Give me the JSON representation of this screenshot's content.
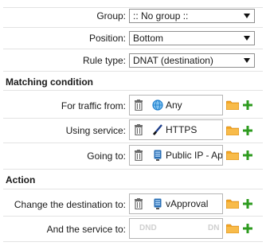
{
  "general": {
    "group": {
      "label": "Group:",
      "value": ":: No group ::"
    },
    "position": {
      "label": "Position:",
      "value": "Bottom"
    },
    "rule_type": {
      "label": "Rule type:",
      "value": "DNAT (destination)"
    }
  },
  "matching": {
    "title": "Matching condition",
    "traffic_from": {
      "label": "For traffic from:",
      "value": "Any",
      "icon": "globe-icon"
    },
    "service": {
      "label": "Using service:",
      "value": "HTTPS",
      "icon": "service-icon"
    },
    "going_to": {
      "label": "Going to:",
      "value": "Public IP - Ap",
      "icon": "network-icon"
    }
  },
  "action": {
    "title": "Action",
    "change_destination": {
      "label": "Change the destination to:",
      "value": "vApproval",
      "icon": "network-icon"
    },
    "change_service": {
      "label": "And the service to:",
      "placeholder_left": "DND",
      "placeholder_right": "DN"
    }
  },
  "colors": {
    "folder": "#f5a623",
    "plus": "#2e9b1f",
    "trash": "#6b6b6b",
    "globe": "#1e7fcf",
    "network": "#2a6fb5"
  }
}
